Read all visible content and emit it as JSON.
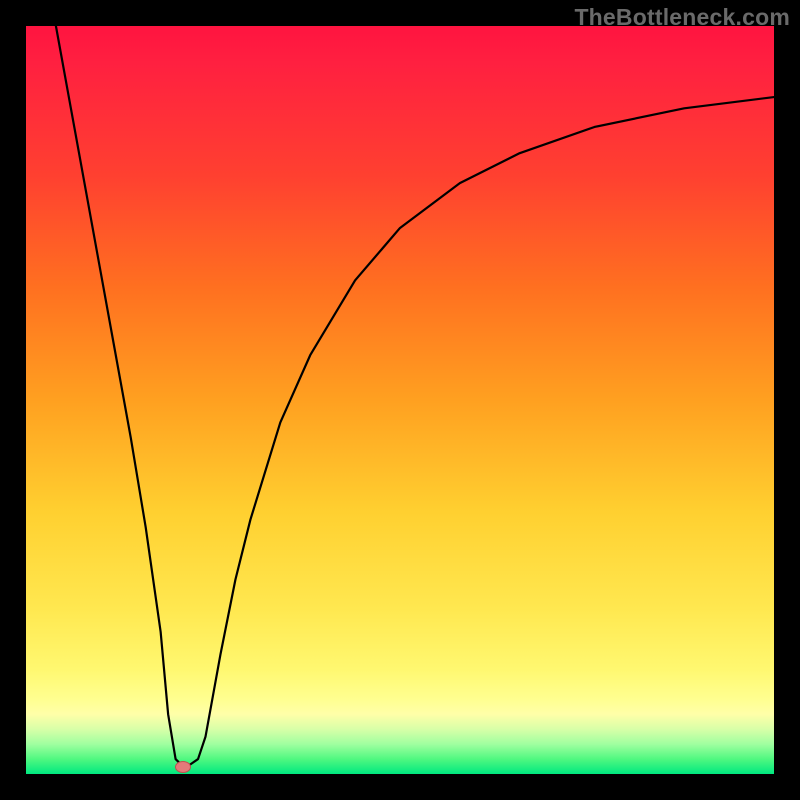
{
  "watermark": "TheBottleneck.com",
  "chart_data": {
    "type": "line",
    "title": "",
    "xlabel": "",
    "ylabel": "",
    "xlim": [
      0,
      100
    ],
    "ylim": [
      0,
      100
    ],
    "grid": false,
    "series": [
      {
        "name": "curve",
        "x": [
          4,
          6,
          8,
          10,
          12,
          14,
          16,
          18,
          19,
          20,
          21,
          22,
          23,
          24,
          26,
          28,
          30,
          34,
          38,
          44,
          50,
          58,
          66,
          76,
          88,
          100
        ],
        "y": [
          100,
          89,
          78,
          67,
          56,
          45,
          33,
          19,
          8,
          2,
          1,
          1.3,
          2,
          5,
          16,
          26,
          34,
          47,
          56,
          66,
          73,
          79,
          83,
          86.5,
          89,
          90.5
        ]
      }
    ],
    "marker": {
      "x": 21,
      "y": 1
    },
    "gradient_stops": [
      {
        "pos": 0,
        "color": "#ff1440"
      },
      {
        "pos": 50,
        "color": "#ffa020"
      },
      {
        "pos": 90,
        "color": "#ffff90"
      },
      {
        "pos": 100,
        "color": "#00e880"
      }
    ]
  }
}
